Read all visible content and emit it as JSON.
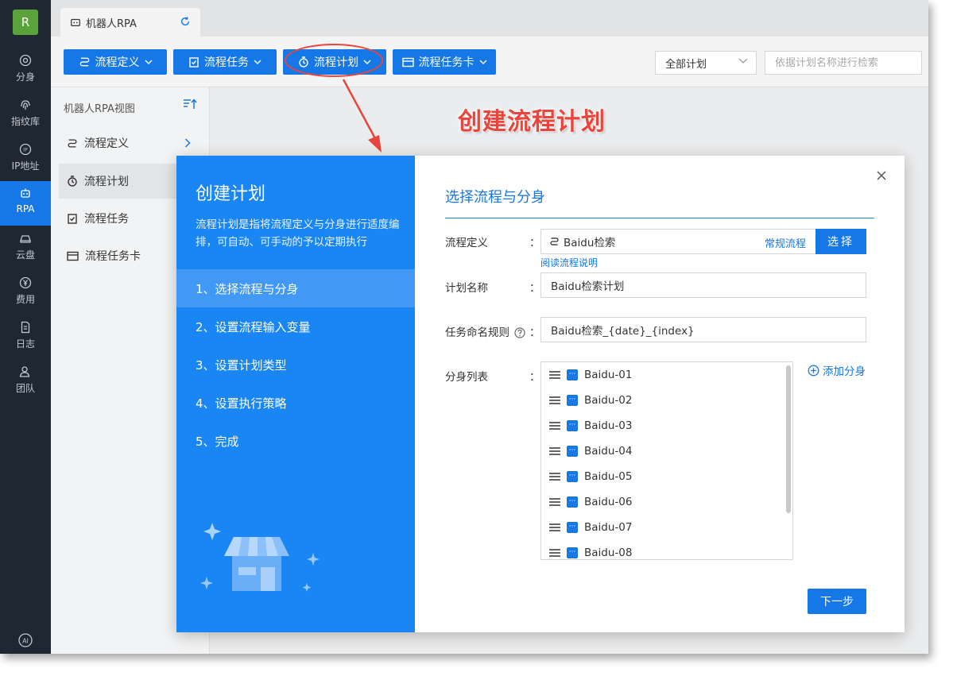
{
  "app": {
    "logo_text": "R",
    "tab_title": "机器人RPA"
  },
  "nav": [
    {
      "label": "分身",
      "icon": "chrome-icon"
    },
    {
      "label": "指纹库",
      "icon": "fingerprint-icon"
    },
    {
      "label": "IP地址",
      "icon": "ip-icon"
    },
    {
      "label": "RPA",
      "icon": "robot-icon",
      "active": true
    },
    {
      "label": "云盘",
      "icon": "cloud-drive-icon"
    },
    {
      "label": "费用",
      "icon": "yen-icon"
    },
    {
      "label": "日志",
      "icon": "log-icon"
    },
    {
      "label": "团队",
      "icon": "team-icon"
    }
  ],
  "toolbar": {
    "process_def": "流程定义",
    "process_task": "流程任务",
    "process_plan": "流程计划",
    "process_task_card": "流程任务卡",
    "plan_filter": "全部计划",
    "search_placeholder": "依据计划名称进行检索"
  },
  "side": {
    "header": "机器人RPA视图",
    "items": [
      "流程定义",
      "流程计划",
      "流程任务",
      "流程任务卡"
    ]
  },
  "annotation": {
    "callout": "创建流程计划",
    "color": "#e8463c"
  },
  "modal": {
    "title": "创建计划",
    "description": "流程计划是指将流程定义与分身进行适度编排，可自动、可手动的予以定期执行",
    "steps": [
      "1、选择流程与分身",
      "2、设置流程输入变量",
      "3、设置计划类型",
      "4、设置执行策略",
      "5、完成"
    ],
    "section_title": "选择流程与分身",
    "form": {
      "process_label": "流程定义",
      "process_value": "Baidu检索",
      "process_type": "常规流程",
      "choose_button": "选择",
      "read_link": "阅读流程说明",
      "plan_name_label": "计划名称",
      "plan_name_value": "Baidu检索计划",
      "task_rule_label": "任务命名规则",
      "task_rule_value": "Baidu检索_{date}_{index}",
      "clone_list_label": "分身列表",
      "add_clone": "添加分身",
      "colon": "："
    },
    "clones": [
      "Baidu-01",
      "Baidu-02",
      "Baidu-03",
      "Baidu-04",
      "Baidu-05",
      "Baidu-06",
      "Baidu-07",
      "Baidu-08"
    ],
    "next_button": "下一步"
  },
  "colors": {
    "primary": "#1677e6",
    "modal_left": "#1a86f3",
    "nav_bg": "#1f2733"
  }
}
